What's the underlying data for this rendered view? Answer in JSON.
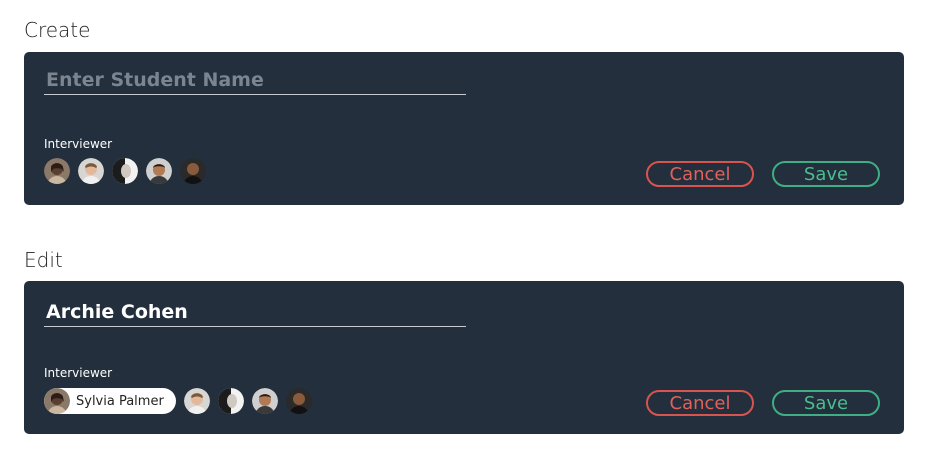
{
  "create": {
    "section_title": "Create",
    "name_placeholder": "Enter Student Name",
    "name_value": "",
    "interviewer_label": "Interviewer",
    "avatars": [
      "avatar-1",
      "avatar-2",
      "avatar-3",
      "avatar-4",
      "avatar-5"
    ],
    "cancel_label": "Cancel",
    "save_label": "Save"
  },
  "edit": {
    "section_title": "Edit",
    "name_value": "Archie Cohen",
    "interviewer_label": "Interviewer",
    "selected_interviewer": "Sylvia Palmer",
    "cancel_label": "Cancel",
    "save_label": "Save"
  },
  "colors": {
    "card_bg": "#232f3c",
    "cancel": "#e0625a",
    "save": "#4bbd8e"
  }
}
